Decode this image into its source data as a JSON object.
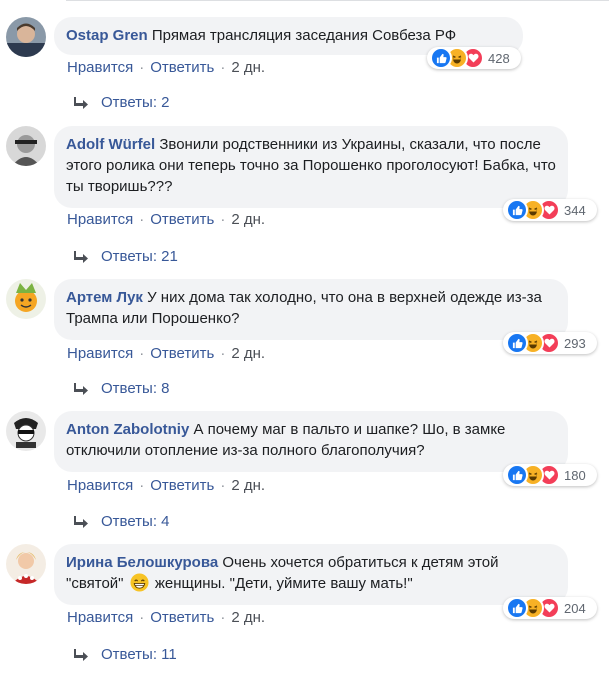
{
  "comments": [
    {
      "author": "Ostap Gren",
      "text": "Прямая трансляция заседания Совбеза РФ",
      "like_label": "Нравится",
      "reply_label": "Ответить",
      "time": "2 дн.",
      "reactions_count": "428",
      "replies_label": "Ответы: 2"
    },
    {
      "author": "Adolf Würfel",
      "text": "Звонили родственники из Украины, сказали, что после этого ролика они теперь точно за Порошенко проголосуют! Бабка, что ты творишь???",
      "like_label": "Нравится",
      "reply_label": "Ответить",
      "time": "2 дн.",
      "reactions_count": "344",
      "replies_label": "Ответы: 21"
    },
    {
      "author": "Артем Лук",
      "text": "У них дома так холодно, что она в верхней одежде из-за Трампа или Порошенко?",
      "like_label": "Нравится",
      "reply_label": "Ответить",
      "time": "2 дн.",
      "reactions_count": "293",
      "replies_label": "Ответы: 8"
    },
    {
      "author": "Anton Zabolotniy",
      "text": "А почему маг в пальто и шапке? Шо, в замке отключили отопление из-за полного благополучия?",
      "like_label": "Нравится",
      "reply_label": "Ответить",
      "time": "2 дн.",
      "reactions_count": "180",
      "replies_label": "Ответы: 4"
    },
    {
      "author": "Ирина Белошкурова",
      "text_before_emoji": "Очень хочется обратиться к детям этой \"святой\"",
      "text_after_emoji": "женщины. \"Дети, уймите вашу мать!\"",
      "like_label": "Нравится",
      "reply_label": "Ответить",
      "time": "2 дн.",
      "reactions_count": "204",
      "replies_label": "Ответы: 11"
    }
  ],
  "colors": {
    "author": "#385898",
    "bubble": "#f2f3f5",
    "like": "#1877f2",
    "haha": "#f7b125",
    "love": "#f33e58"
  },
  "icons": [
    "like-reaction-icon",
    "haha-reaction-icon",
    "love-reaction-icon",
    "reply-arrow-icon",
    "grinning-emoji-icon"
  ]
}
